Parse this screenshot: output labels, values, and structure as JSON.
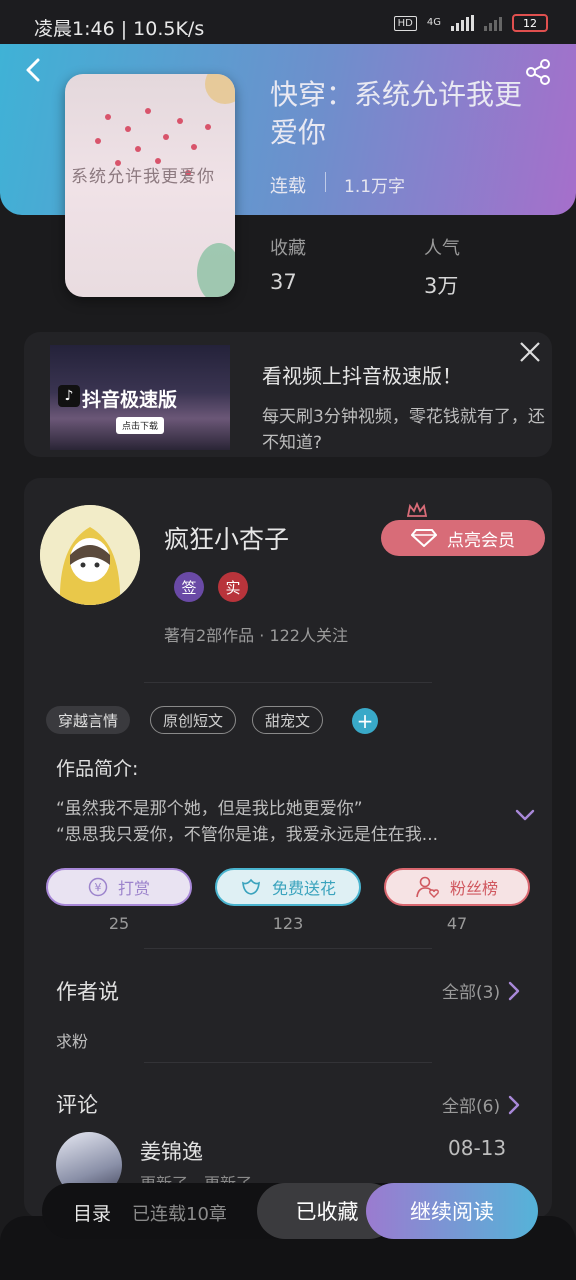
{
  "status_bar": {
    "time": "凌晨1:46",
    "speed": "10.5K/s",
    "hd": "HD",
    "network": "4G",
    "battery": "12"
  },
  "book": {
    "title": "快穿：系统允许我更爱你",
    "cover_text": "系统允许我更爱你",
    "status": "连载",
    "words": "1.1万字",
    "stats": [
      {
        "label": "收藏",
        "value": "37"
      },
      {
        "label": "人气",
        "value": "3万"
      }
    ]
  },
  "ad": {
    "image_title": "抖音极速版",
    "image_button": "点击下载",
    "title": "看视频上抖音极速版！",
    "desc": "每天刷3分钟视频，零花钱就有了，还不知道?"
  },
  "author": {
    "name": "疯狂小杏子",
    "badges": [
      "签",
      "实"
    ],
    "meta": "著有2部作品 · 122人关注",
    "vip_label": "点亮会员"
  },
  "tags": [
    "穿越言情",
    "原创短文",
    "甜宠文"
  ],
  "intro": {
    "label": "作品简介:",
    "lines": [
      "“虽然我不是那个她，但是我比她更爱你”",
      "“思思我只爱你，不管你是谁，我爱永远是住在我..."
    ]
  },
  "actions": [
    {
      "label": "打赏",
      "count": "25",
      "color": "#a888d8"
    },
    {
      "label": "免费送花",
      "count": "123",
      "color": "#4ab4cf"
    },
    {
      "label": "粉丝榜",
      "count": "47",
      "color": "#d9676f"
    }
  ],
  "author_says": {
    "title": "作者说",
    "more": "全部(3)",
    "content": "求粉"
  },
  "comments": {
    "title": "评论",
    "more": "全部(6)",
    "items": [
      {
        "name": "姜锦逸",
        "date": "08-13",
        "text": "更新了，更新了"
      }
    ]
  },
  "bottom": {
    "toc": "目录",
    "toc_count": "已连载10章",
    "fav": "已收藏",
    "read": "继续阅读"
  },
  "colors": {
    "header_gradient_start": "#3fb2d6",
    "header_gradient_end": "#a66fcb",
    "vip": "#d86c78",
    "accent_blue": "#39a9c8"
  }
}
